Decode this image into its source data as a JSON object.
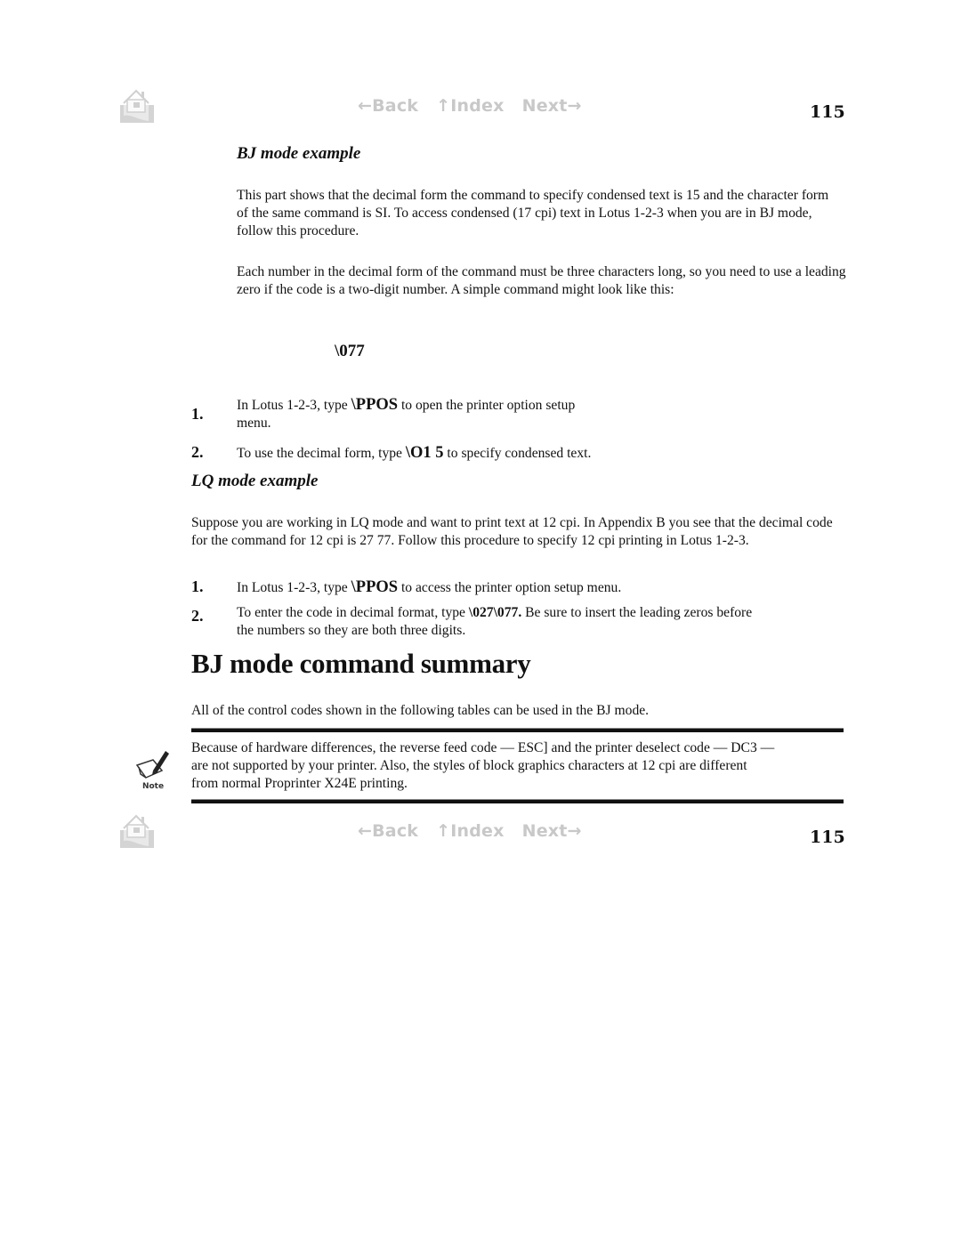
{
  "nav": {
    "home_icon": "home-icon",
    "back_label": "←Back",
    "index_label": "↑Index",
    "next_label": "Next→",
    "page_number": "115",
    "nav_color": "#c8c8c8"
  },
  "bj_example": {
    "heading": "BJ mode example",
    "para1": "This part shows that the decimal form the command to specify condensed text is 15 and the character form of the same command is SI. To access condensed (17 cpi) text in Lotus 1-2-3 when you are in BJ mode, follow this procedure.",
    "para2": "Each number in the decimal form of the command must be three characters long, so you need to use a leading zero if the code is a two-digit number. A simple command might look like this:",
    "sample_command": "\\077",
    "steps": [
      {
        "num": "1.",
        "pre": "In Lotus 1-2-3, type ",
        "code": "\\PPOS",
        "post": " to open the printer option setup",
        "post2": "menu."
      },
      {
        "num": "2.",
        "pre": "To use the decimal form, type ",
        "code": "\\O1 5",
        "post": " to specify condensed text."
      }
    ]
  },
  "lq_example": {
    "heading": "LQ mode example",
    "para": "Suppose you are working in LQ mode and want to print text at 12 cpi. In Appendix B you see that the decimal code for the command for 12 cpi is 27 77. Follow this procedure to specify 12 cpi printing in Lotus 1-2-3.",
    "steps": [
      {
        "num": "1.",
        "pre": "In Lotus 1-2-3, type ",
        "code": "\\PPOS",
        "post": " to access the printer option setup menu."
      },
      {
        "num": "2.",
        "pre": "To enter the code in decimal format, type ",
        "code": "\\027\\077.",
        "post": " Be sure to insert the leading zeros before",
        "post2": "the numbers so they are both three digits."
      }
    ]
  },
  "summary": {
    "heading": "BJ mode command summary",
    "para": "All of the control codes shown in the following tables can be used in the BJ mode."
  },
  "note": {
    "icon": "note-icon",
    "icon_label": "Note",
    "line1": "Because of hardware differences, the reverse feed code — ESC] and the printer deselect code — DC3 —",
    "line2": "are not supported by your printer. Also, the styles of block graphics characters at 12 cpi are different",
    "line3": "from normal Proprinter X24E printing."
  }
}
